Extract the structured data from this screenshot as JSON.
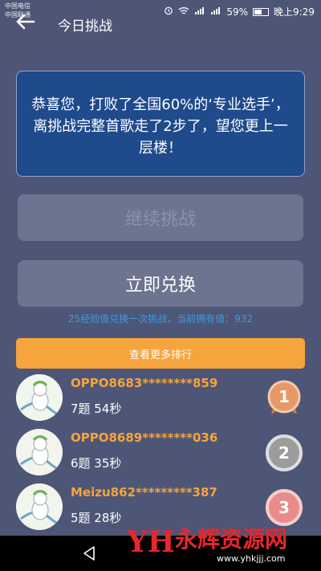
{
  "status_bar": {
    "carrier_1": "中国电信",
    "carrier_2": "中国联通",
    "battery": "59%",
    "battery_level": 0.59,
    "time": "晚上9:29"
  },
  "app_bar": {
    "title": "今日挑战"
  },
  "result_message": "恭喜您，打败了全国60%的‘专业选手’，离挑战完整首歌走了2步了，望您更上一层楼！",
  "buttons": {
    "continue": "继续挑战",
    "redeem": "立即兑换"
  },
  "redeem_hint": "25经验值兑换一次挑战，当前拥有值：932",
  "more_rankings": "查看更多排行",
  "rankings": [
    {
      "name": "OPPO8683********859",
      "score": "7题 54秒",
      "rank": "1",
      "medal_color": "#e08c55"
    },
    {
      "name": "OPPO8689********036",
      "score": "6题 35秒",
      "rank": "2",
      "medal_color": "#a9a9a9"
    },
    {
      "name": "Meizu862*********387",
      "score": "5题 28秒",
      "rank": "3",
      "medal_color": "#e88a8a"
    }
  ],
  "watermark": {
    "logo": "YH",
    "text": "永辉资源网",
    "url": "www.yhkjjj.com"
  }
}
